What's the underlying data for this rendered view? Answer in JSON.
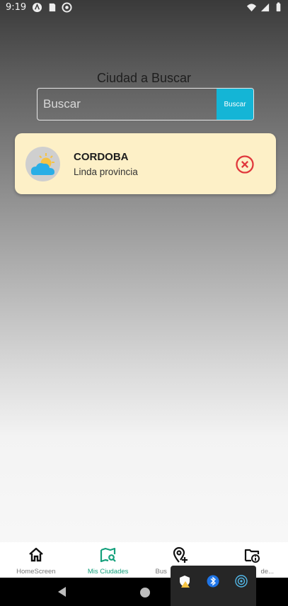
{
  "status_bar": {
    "time": "9:19",
    "left_icons": [
      "a-icon",
      "sd-card-icon",
      "app-icon"
    ],
    "right_icons": [
      "wifi-icon",
      "signal-icon",
      "battery-icon"
    ]
  },
  "search": {
    "title": "Ciudad a Buscar",
    "placeholder": "Buscar",
    "button_label": "Buscar",
    "accent_color": "#14b5d6"
  },
  "cities": [
    {
      "name": "CORDOBA",
      "subtitle": "Linda provincia",
      "icon": "partly-cloudy-icon",
      "card_color": "#fdf0c7",
      "delete_icon": "close-circle-icon"
    }
  ],
  "bottom_nav": {
    "active_color": "#14a07c",
    "items": [
      {
        "label": "HomeScreen",
        "icon": "home-icon",
        "active": false
      },
      {
        "label": "Mis Ciudades",
        "icon": "map-search-icon",
        "active": true
      },
      {
        "label": "Bus",
        "icon": "add-location-icon",
        "active": false
      },
      {
        "label": "de...",
        "icon": "folder-info-icon",
        "active": false
      }
    ]
  },
  "overlay": {
    "icons": [
      "shield-warning-icon",
      "bluetooth-icon",
      "hotspot-icon"
    ]
  }
}
